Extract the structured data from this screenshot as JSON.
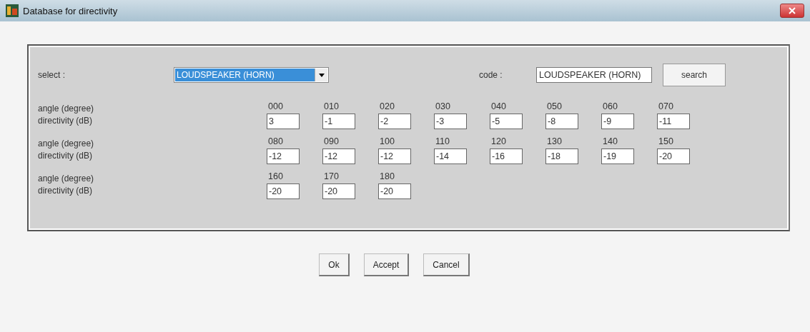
{
  "window": {
    "title": "Database for directivity"
  },
  "select": {
    "label": "select :",
    "value": "LOUDSPEAKER (HORN)"
  },
  "code": {
    "label": "code :",
    "value": "LOUDSPEAKER (HORN)"
  },
  "search_button": "search",
  "rows": [
    {
      "angle_label": "angle (degree)",
      "directivity_label": "directivity  (dB)",
      "points": [
        {
          "angle": "000",
          "value": "3"
        },
        {
          "angle": "010",
          "value": "-1"
        },
        {
          "angle": "020",
          "value": "-2"
        },
        {
          "angle": "030",
          "value": "-3"
        },
        {
          "angle": "040",
          "value": "-5"
        },
        {
          "angle": "050",
          "value": "-8"
        },
        {
          "angle": "060",
          "value": "-9"
        },
        {
          "angle": "070",
          "value": "-11"
        }
      ]
    },
    {
      "angle_label": "angle (degree)",
      "directivity_label": "directivity  (dB)",
      "points": [
        {
          "angle": "080",
          "value": "-12"
        },
        {
          "angle": "090",
          "value": "-12"
        },
        {
          "angle": "100",
          "value": "-12"
        },
        {
          "angle": "110",
          "value": "-14"
        },
        {
          "angle": "120",
          "value": "-16"
        },
        {
          "angle": "130",
          "value": "-18"
        },
        {
          "angle": "140",
          "value": "-19"
        },
        {
          "angle": "150",
          "value": "-20"
        }
      ]
    },
    {
      "angle_label": "angle (degree)",
      "directivity_label": "directivity  (dB)",
      "points": [
        {
          "angle": "160",
          "value": "-20"
        },
        {
          "angle": "170",
          "value": "-20"
        },
        {
          "angle": "180",
          "value": "-20"
        }
      ]
    }
  ],
  "buttons": [
    "Ok",
    "Accept",
    "Cancel"
  ]
}
